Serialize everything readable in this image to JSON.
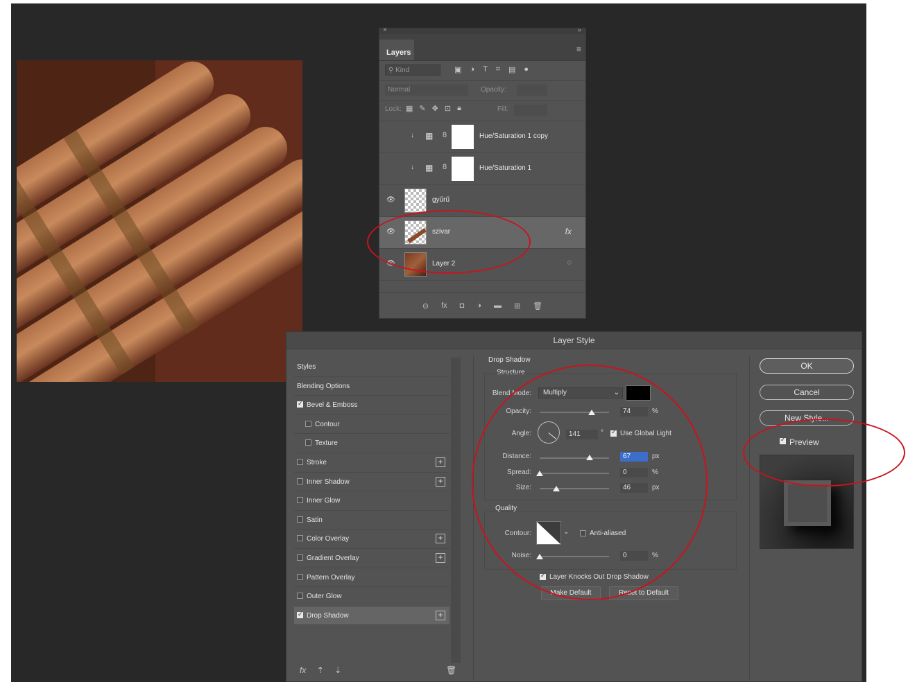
{
  "layers_panel": {
    "tab": "Layers",
    "search_placeholder": "Kind",
    "blend_mode": "Normal",
    "opacity_label": "Opacity:",
    "lock_label": "Lock:",
    "fill_label": "Fill:",
    "layers": [
      {
        "name": "Hue/Saturation 1 copy",
        "visible": false,
        "type": "adjustment"
      },
      {
        "name": "Hue/Saturation 1",
        "visible": false,
        "type": "adjustment"
      },
      {
        "name": "gyűrű",
        "visible": true,
        "type": "pixel"
      },
      {
        "name": "szivar",
        "visible": true,
        "type": "pixel",
        "badge": "fx",
        "selected": true
      },
      {
        "name": "Layer 2",
        "visible": true,
        "type": "smart"
      }
    ]
  },
  "dialog": {
    "title": "Layer Style",
    "styles": [
      {
        "label": "Styles",
        "kind": "header"
      },
      {
        "label": "Blending Options",
        "kind": "header"
      },
      {
        "label": "Bevel & Emboss",
        "checked": true
      },
      {
        "label": "Contour",
        "checked": false,
        "sub": true
      },
      {
        "label": "Texture",
        "checked": false,
        "sub": true
      },
      {
        "label": "Stroke",
        "checked": false,
        "plus": true
      },
      {
        "label": "Inner Shadow",
        "checked": false,
        "plus": true
      },
      {
        "label": "Inner Glow",
        "checked": false
      },
      {
        "label": "Satin",
        "checked": false
      },
      {
        "label": "Color Overlay",
        "checked": false,
        "plus": true
      },
      {
        "label": "Gradient Overlay",
        "checked": false,
        "plus": true
      },
      {
        "label": "Pattern Overlay",
        "checked": false
      },
      {
        "label": "Outer Glow",
        "checked": false
      },
      {
        "label": "Drop Shadow",
        "checked": true,
        "plus": true,
        "active": true
      }
    ],
    "footer_icon": "fx",
    "drop_shadow": {
      "section_title": "Drop Shadow",
      "structure_title": "Structure",
      "blend_mode_label": "Blend Mode:",
      "blend_mode_value": "Multiply",
      "shadow_color": "#000000",
      "opacity_label": "Opacity:",
      "opacity_value": "74",
      "angle_label": "Angle:",
      "angle_value": "141",
      "use_global_light_label": "Use Global Light",
      "distance_label": "Distance:",
      "distance_value": "67",
      "spread_label": "Spread:",
      "spread_value": "0",
      "size_label": "Size:",
      "size_value": "46",
      "quality_title": "Quality",
      "contour_label": "Contour:",
      "anti_aliased_label": "Anti-aliased",
      "noise_label": "Noise:",
      "noise_value": "0",
      "knockout_label": "Layer Knocks Out Drop Shadow",
      "make_default_label": "Make Default",
      "reset_default_label": "Reset to Default",
      "unit_percent": "%",
      "unit_px": "px",
      "unit_degree": "°"
    },
    "buttons": {
      "ok": "OK",
      "cancel": "Cancel",
      "new_style": "New Style...",
      "preview_label": "Preview"
    }
  }
}
